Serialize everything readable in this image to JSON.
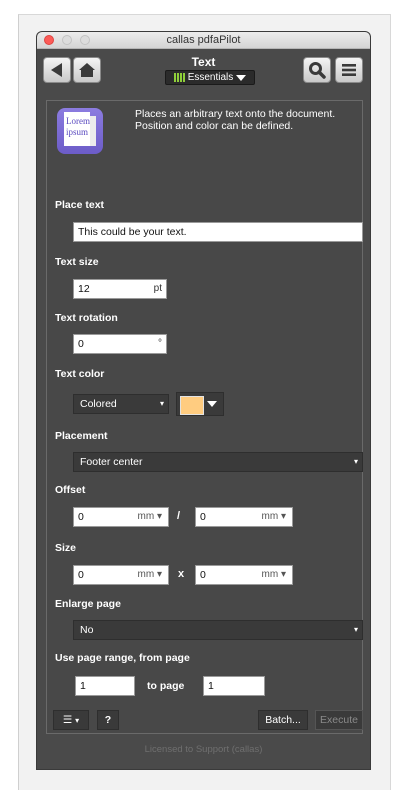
{
  "window": {
    "title": "callas pdfaPilot"
  },
  "toolbar": {
    "back_icon": "triangle-left-icon",
    "home_icon": "home-icon",
    "search_icon": "magnifier-icon",
    "menu_icon": "hamburger-menu-icon",
    "tool_title": "Text",
    "profile_label": "Essentials",
    "profile_icon": "bars-chart-icon"
  },
  "description": {
    "icon_text_line1": "Lorem",
    "icon_text_line2": "ipsum",
    "text": "Places an arbitrary text onto the document. Position and color can be defined."
  },
  "form": {
    "place_text": {
      "label": "Place text",
      "value": "This could be your text."
    },
    "text_size": {
      "label": "Text size",
      "value": "12",
      "unit": "pt"
    },
    "text_rotation": {
      "label": "Text rotation",
      "value": "0",
      "unit": "°"
    },
    "text_color": {
      "label": "Text color",
      "mode": "Colored",
      "swatch_color": "#ffcc80"
    },
    "placement": {
      "label": "Placement",
      "value": "Footer center"
    },
    "offset": {
      "label": "Offset",
      "x": "0",
      "x_unit": "mm",
      "separator": "/",
      "y": "0",
      "y_unit": "mm"
    },
    "size": {
      "label": "Size",
      "w": "0",
      "w_unit": "mm",
      "separator": "x",
      "h": "0",
      "h_unit": "mm"
    },
    "enlarge_page": {
      "label": "Enlarge page",
      "value": "No"
    },
    "page_range": {
      "label": "Use page range, from page",
      "from": "1",
      "to_label": "to page",
      "to": "1"
    }
  },
  "actions": {
    "menu_glyph": "☰",
    "help_label": "?",
    "batch_label": "Batch...",
    "execute_label": "Execute"
  },
  "footer": {
    "license": "Licensed to Support (callas)"
  },
  "colors": {
    "panel_bg": "#484848",
    "essentials_accent": "#8fcf3a",
    "close_red": "#fc5b57"
  }
}
